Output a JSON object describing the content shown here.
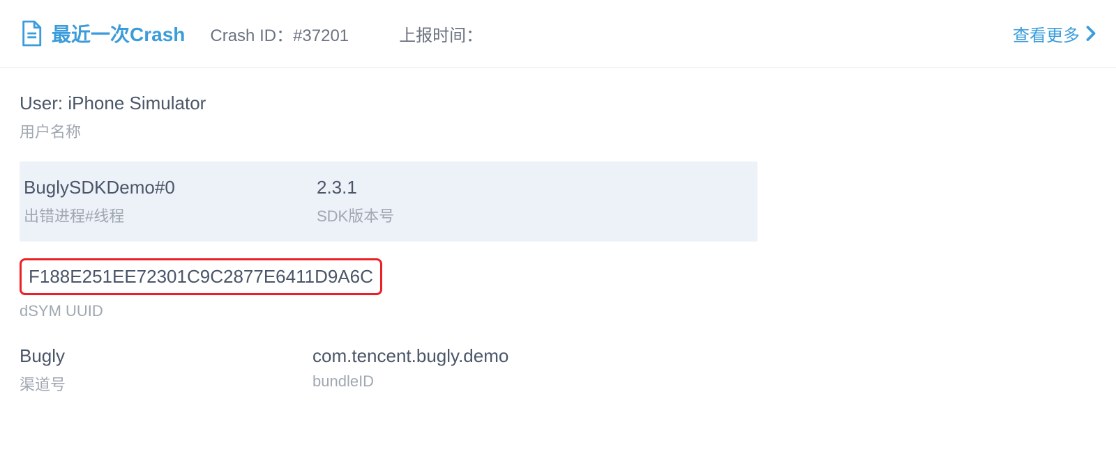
{
  "header": {
    "title": "最近一次Crash",
    "crash_id_label": "Crash ID：",
    "crash_id_value": "#37201",
    "report_time_label": "上报时间：",
    "report_time_value": "",
    "view_more": "查看更多"
  },
  "user": {
    "value": "User: iPhone Simulator",
    "label": "用户名称"
  },
  "process": {
    "value": "BuglySDKDemo#0",
    "label": "出错进程#线程"
  },
  "sdk": {
    "value": "2.3.1",
    "label": "SDK版本号"
  },
  "dsym": {
    "value": "F188E251EE72301C9C2877E6411D9A6C",
    "label": "dSYM UUID"
  },
  "channel": {
    "value": "Bugly",
    "label": "渠道号"
  },
  "bundle": {
    "value": "com.tencent.bugly.demo",
    "label": "bundleID"
  }
}
